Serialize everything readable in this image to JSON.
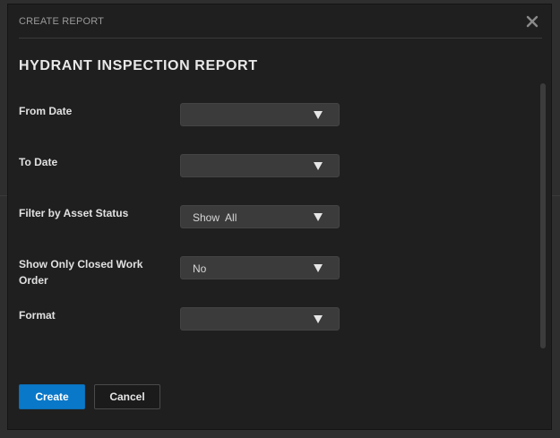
{
  "dialog": {
    "title": "CREATE REPORT",
    "close_icon": "close-icon"
  },
  "report": {
    "title": "HYDRANT INSPECTION REPORT"
  },
  "fields": {
    "from_date": {
      "label": "From Date",
      "value": ""
    },
    "to_date": {
      "label": "To Date",
      "value": ""
    },
    "asset_status": {
      "label": "Filter by Asset Status",
      "value": "Show  All"
    },
    "closed_work_order": {
      "label": "Show Only Closed Work Order",
      "value": "No"
    },
    "format": {
      "label": "Format",
      "value": ""
    }
  },
  "buttons": {
    "create": "Create",
    "cancel": "Cancel"
  },
  "colors": {
    "dialog_bg": "#1f1f1f",
    "select_bg": "#3b3b3b",
    "primary": "#0a78c8"
  }
}
